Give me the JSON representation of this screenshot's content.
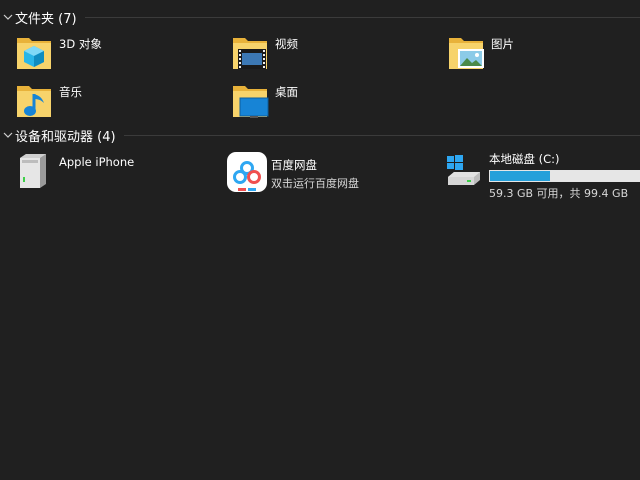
{
  "sections": {
    "folders": {
      "title": "文件夹 (7)"
    },
    "devices": {
      "title": "设备和驱动器 (4)"
    }
  },
  "folders": {
    "objects3d": {
      "label": "3D 对象",
      "icon": "3d-objects-folder-icon"
    },
    "videos": {
      "label": "视频",
      "icon": "videos-folder-icon"
    },
    "pictures": {
      "label": "图片",
      "icon": "pictures-folder-icon"
    },
    "music": {
      "label": "音乐",
      "icon": "music-folder-icon"
    },
    "desktop": {
      "label": "桌面",
      "icon": "desktop-folder-icon"
    }
  },
  "devices": {
    "iphone": {
      "label": "Apple iPhone",
      "icon": "portable-device-icon"
    },
    "baidu": {
      "label": "百度网盘",
      "sub": "双击运行百度网盘",
      "icon": "baidu-netdisk-icon"
    },
    "cdrive": {
      "label": "本地磁盘 (C:)",
      "sub": "59.3 GB 可用，共 99.4 GB",
      "icon": "windows-drive-icon",
      "used_fraction": 0.403
    }
  },
  "colors": {
    "background": "#202020",
    "bar_fill": "#26a0da",
    "bar_track": "#e6e6e6",
    "folder_yellow": "#f5c542"
  }
}
